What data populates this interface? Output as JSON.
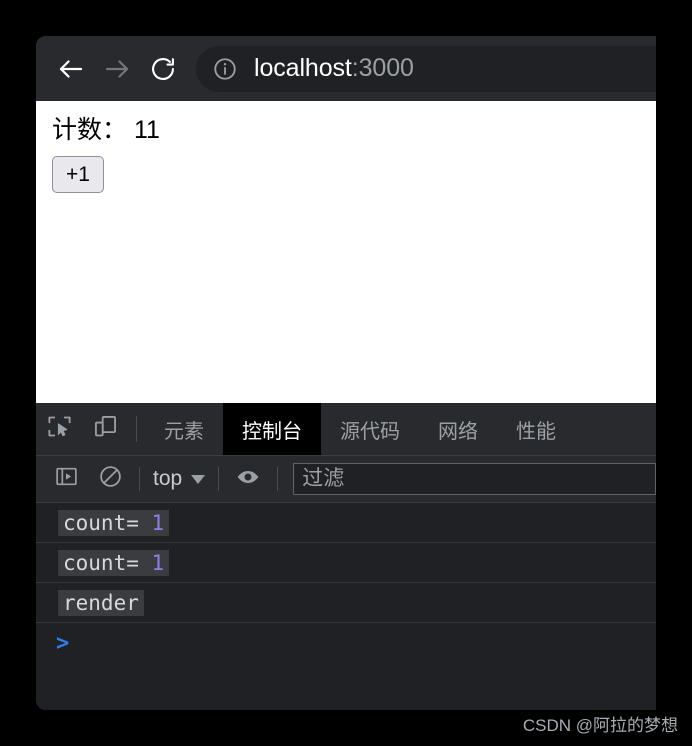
{
  "browser": {
    "back_icon": "arrow-left-icon",
    "forward_icon": "arrow-right-icon",
    "reload_icon": "reload-icon",
    "address_bar": {
      "site_info_icon": "info-circle-icon",
      "host": "localhost",
      "port": ":3000"
    }
  },
  "page": {
    "counter_label": "计数： 11",
    "increment_button": "+1"
  },
  "devtools": {
    "inspect_icon": "inspect-element-icon",
    "device_toolbar_icon": "device-toolbar-icon",
    "tabs": [
      {
        "label": "元素",
        "active": false
      },
      {
        "label": "控制台",
        "active": true
      },
      {
        "label": "源代码",
        "active": false
      },
      {
        "label": "网络",
        "active": false
      },
      {
        "label": "性能",
        "active": false
      }
    ],
    "console_toolbar": {
      "sidebar_icon": "console-sidebar-icon",
      "clear_icon": "clear-console-icon",
      "context": "top",
      "context_caret_icon": "chevron-down-icon",
      "eye_icon": "live-expression-eye-icon",
      "filter_placeholder": "过滤",
      "filter_value": ""
    },
    "console_messages": [
      {
        "text": "count= ",
        "number": "1"
      },
      {
        "text": "count= ",
        "number": "1"
      },
      {
        "text": "render",
        "number": ""
      }
    ],
    "prompt_symbol": ">"
  },
  "watermark": "CSDN @阿拉的梦想",
  "colors": {
    "accent_blue": "#2f7eea",
    "number_violet": "#8f7fe8",
    "chrome_bg": "#292a2d",
    "devtools_bg": "#202124"
  }
}
